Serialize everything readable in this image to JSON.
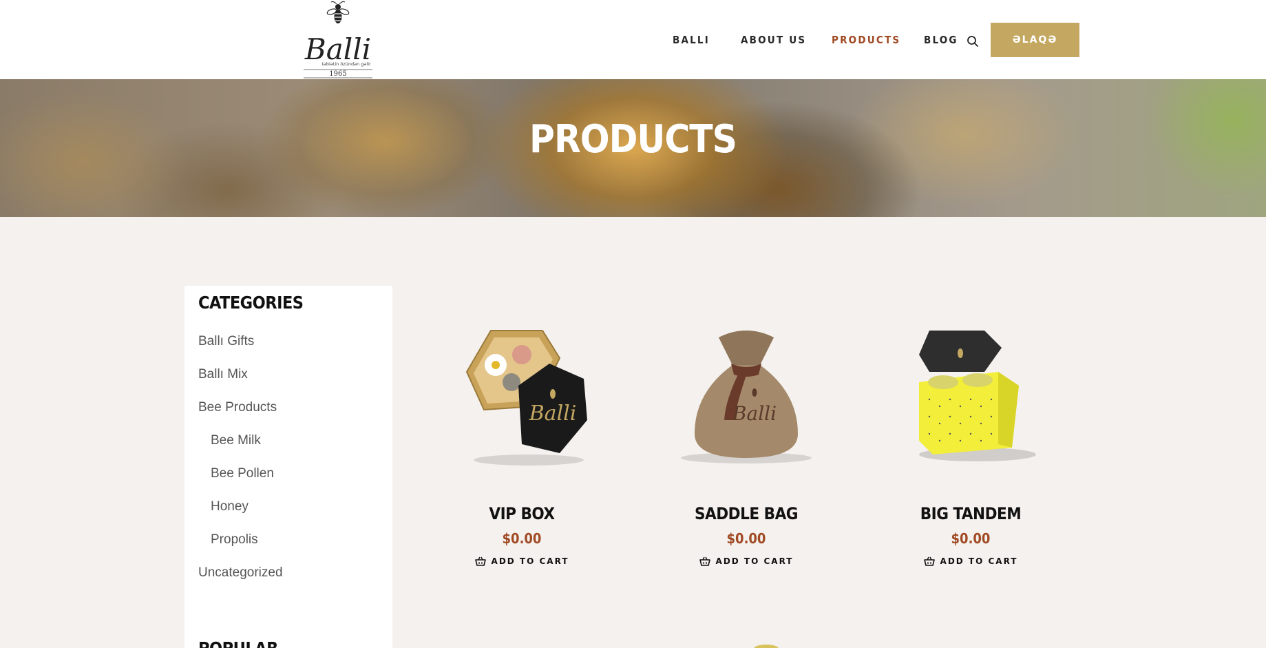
{
  "header": {
    "logo": {
      "brand": "Balli",
      "tagline": "təbiətin özündən gəlir",
      "year": "1965"
    },
    "nav": [
      {
        "label": "BALLI",
        "active": false
      },
      {
        "label": "ABOUT US",
        "active": false
      },
      {
        "label": "PRODUCTS",
        "active": true
      },
      {
        "label": "BLOG",
        "active": false
      }
    ],
    "search_icon": "search-icon",
    "contact_label": "ƏLAQƏ"
  },
  "banner": {
    "title": "PRODUCTS"
  },
  "sidebar": {
    "title": "CATEGORIES",
    "categories": [
      {
        "label": "Ballı Gifts",
        "level": 0
      },
      {
        "label": "Ballı Mix",
        "level": 0
      },
      {
        "label": "Bee Products",
        "level": 0
      },
      {
        "label": "Bee Milk",
        "level": 1
      },
      {
        "label": "Bee Pollen",
        "level": 1
      },
      {
        "label": "Honey",
        "level": 1
      },
      {
        "label": "Propolis",
        "level": 1
      },
      {
        "label": "Uncategorized",
        "level": 0
      }
    ],
    "title_2": "POPULAR"
  },
  "products": [
    {
      "name": "VIP BOX",
      "price": "$0.00",
      "cta": "ADD TO CART",
      "image": "vip-box-image"
    },
    {
      "name": "SADDLE BAG",
      "price": "$0.00",
      "cta": "ADD TO CART",
      "image": "saddle-bag-image"
    },
    {
      "name": "BIG TANDEM",
      "price": "$0.00",
      "cta": "ADD TO CART",
      "image": "big-tandem-image"
    }
  ],
  "colors": {
    "accent_gold": "#c4a862",
    "price_red": "#a04a24",
    "page_bg": "#f5f1ee",
    "text_dark": "#111111"
  }
}
